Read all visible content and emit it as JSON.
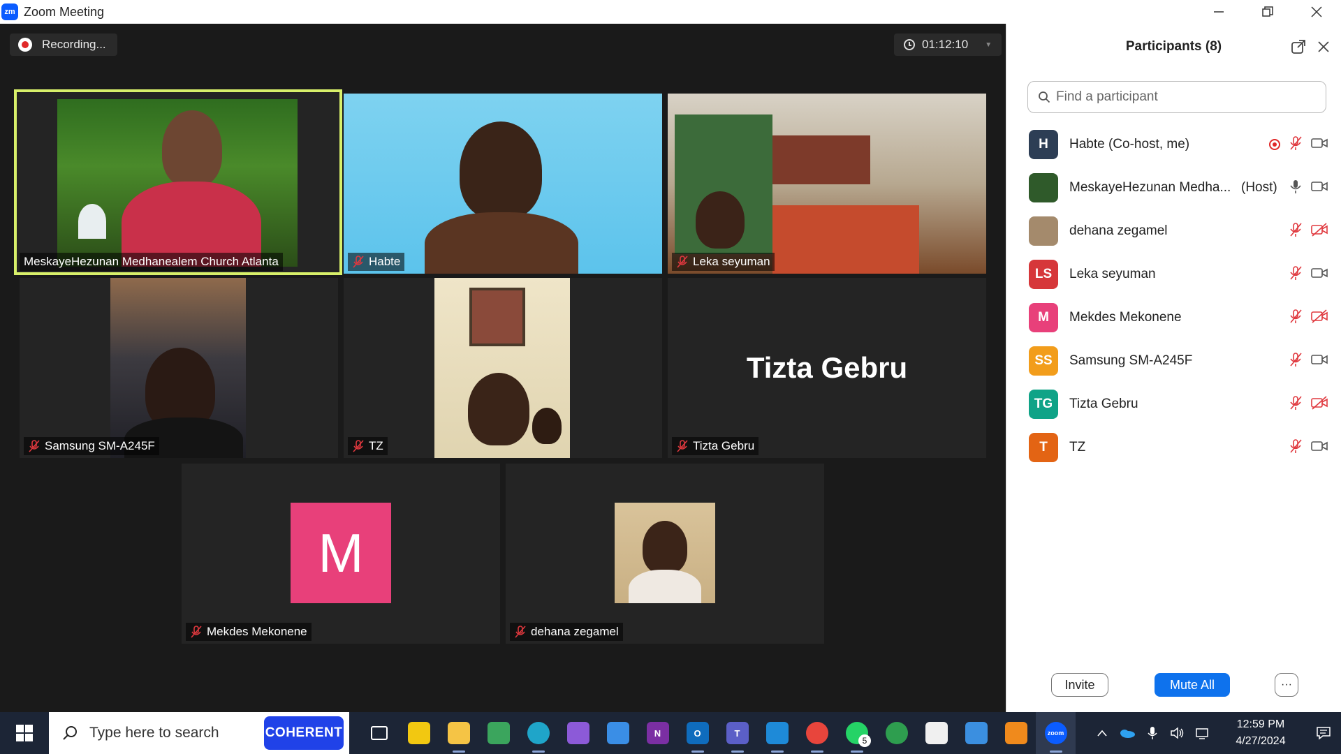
{
  "window": {
    "title": "Zoom Meeting",
    "logo_text": "zm"
  },
  "meeting": {
    "recording_label": "Recording...",
    "elapsed": "01:12:10"
  },
  "tiles": {
    "host": "MeskayeHezunan Medhanealem Church Atlanta",
    "habte": "Habte",
    "leka": "Leka seyuman",
    "samsung": "Samsung SM-A245F",
    "tz": "TZ",
    "tizta": "Tizta Gebru",
    "tizta_center": "Tizta Gebru",
    "mekdes": "Mekdes Mekonene",
    "mekdes_avatar": "M",
    "dehana": "dehana zegamel"
  },
  "panel": {
    "title": "Participants (8)",
    "search_placeholder": "Find a participant",
    "participants": [
      {
        "initials": "H",
        "name": "Habte (Co-host, me)",
        "role": "",
        "avatar_color": "#2d3e55",
        "recording": true,
        "muted": true,
        "video_off": false
      },
      {
        "initials": "",
        "name": "MeskayeHezunan Medha...",
        "role": "(Host)",
        "avatar_color": "#2f5a2a",
        "recording": false,
        "muted": false,
        "video_off": false
      },
      {
        "initials": "",
        "name": "dehana zegamel",
        "role": "",
        "avatar_color": "#a48a6c",
        "recording": false,
        "muted": true,
        "video_off": true
      },
      {
        "initials": "LS",
        "name": "Leka seyuman",
        "role": "",
        "avatar_color": "#d6373a",
        "recording": false,
        "muted": true,
        "video_off": false
      },
      {
        "initials": "M",
        "name": "Mekdes Mekonene",
        "role": "",
        "avatar_color": "#e8407a",
        "recording": false,
        "muted": true,
        "video_off": true
      },
      {
        "initials": "SS",
        "name": "Samsung SM-A245F",
        "role": "",
        "avatar_color": "#f29d1b",
        "recording": false,
        "muted": true,
        "video_off": false
      },
      {
        "initials": "TG",
        "name": "Tizta Gebru",
        "role": "",
        "avatar_color": "#0fa387",
        "recording": false,
        "muted": true,
        "video_off": true
      },
      {
        "initials": "T",
        "name": "TZ",
        "role": "",
        "avatar_color": "#e36414",
        "recording": false,
        "muted": true,
        "video_off": false
      }
    ],
    "invite_label": "Invite",
    "mute_all_label": "Mute All",
    "more_label": "···"
  },
  "taskbar": {
    "search_text": "Type here to search",
    "coherent_label": "COHERENT",
    "whatsapp_badge": "5",
    "time": "12:59 PM",
    "date": "4/27/2024",
    "apps": [
      {
        "name": "task-view",
        "label": "",
        "color": "transparent"
      },
      {
        "name": "power-bi",
        "label": "",
        "color": "#f2c811"
      },
      {
        "name": "file-explorer",
        "label": "",
        "color": "#f5c445"
      },
      {
        "name": "snipping",
        "label": "",
        "color": "#3ba55d"
      },
      {
        "name": "edge",
        "label": "",
        "color": "#1fa5c9"
      },
      {
        "name": "visual-studio",
        "label": "",
        "color": "#8c5ad8"
      },
      {
        "name": "remote-desktop",
        "label": "",
        "color": "#3a8ee6"
      },
      {
        "name": "onenote",
        "label": "N",
        "color": "#7b2fa3"
      },
      {
        "name": "outlook",
        "label": "O",
        "color": "#0f6cbd"
      },
      {
        "name": "teams",
        "label": "T",
        "color": "#5b5fc7"
      },
      {
        "name": "vscode",
        "label": "",
        "color": "#1e8ad8"
      },
      {
        "name": "chrome",
        "label": "",
        "color": "#e8453c"
      },
      {
        "name": "whatsapp",
        "label": "",
        "color": "#25d366"
      },
      {
        "name": "globe",
        "label": "",
        "color": "#2e9e4f"
      },
      {
        "name": "store",
        "label": "",
        "color": "#f0f0f0"
      },
      {
        "name": "photos",
        "label": "",
        "color": "#3b8fe0"
      },
      {
        "name": "vlc",
        "label": "",
        "color": "#f08a1c"
      },
      {
        "name": "zoom",
        "label": "zoom",
        "color": "#0b5cff"
      }
    ]
  }
}
